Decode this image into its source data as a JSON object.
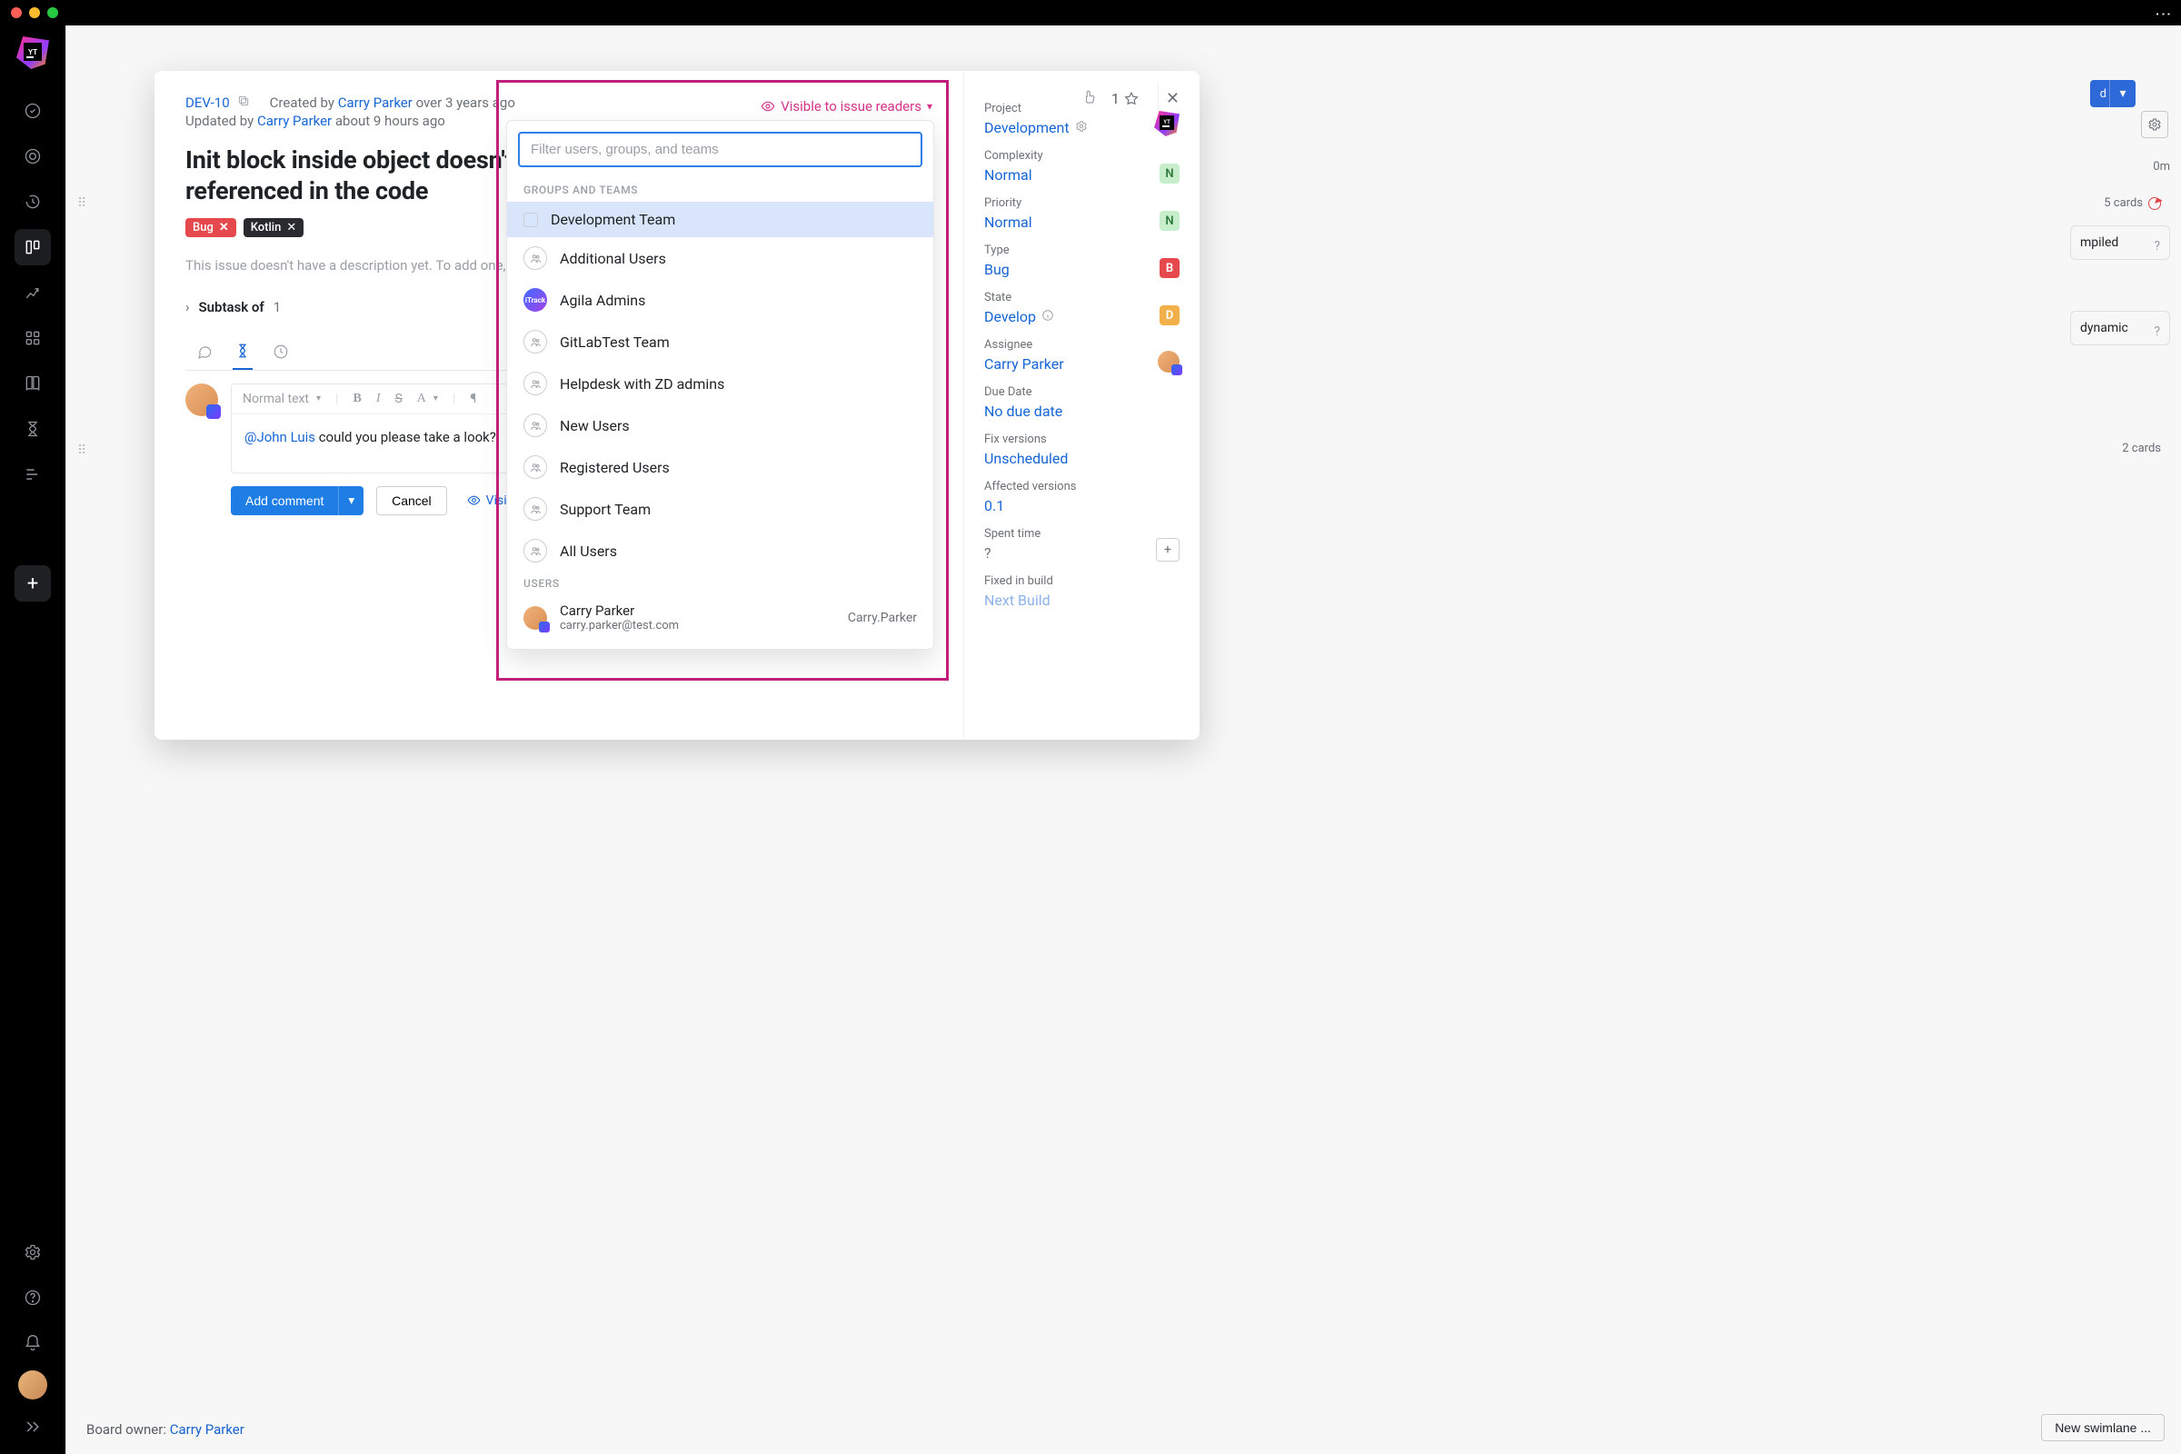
{
  "window": {
    "kebab": "⋮"
  },
  "sidebar": {
    "icons": [
      "target",
      "ring",
      "timer",
      "board",
      "chart",
      "grid",
      "book",
      "hourglass",
      "flow"
    ],
    "add": "+"
  },
  "board": {
    "time_header": "0m",
    "cards5": "5 cards",
    "card1": "mpiled",
    "card1_q": "?",
    "card2": "dynamic",
    "card2_q": "?",
    "cards2": "2 cards",
    "owner_label": "Board owner: ",
    "owner_name": "Carry Parker",
    "swimlane_btn": "New swimlane ...",
    "blue_btn": "d",
    "blue_dd": "▾"
  },
  "issue": {
    "id": "DEV-10",
    "created_prefix": "Created by ",
    "created_by": "Carry Parker",
    "created_ago": " over 3 years ago",
    "updated_prefix": "Updated by ",
    "updated_by": "Carry Parker",
    "updated_ago": " about 9 hours ago",
    "visibility": "Visible to issue readers",
    "title": "Init block inside object doesn't fire execute if the object isn't referenced in the code",
    "tags": {
      "bug": "Bug",
      "kotlin": "Kotlin"
    },
    "nodesc": "This issue doesn't have a description yet. To add one, click here.",
    "subtask_label": "Subtask of",
    "subtask_count": "1"
  },
  "editor": {
    "format_sel": "Normal text",
    "mention": "@John Luis",
    "body_rest": " could you please take a look?"
  },
  "actions": {
    "add_comment": "Add comment",
    "cancel": "Cancel",
    "vis_small": "Visible to issue readers"
  },
  "side": {
    "star_count": "1",
    "project_label": "Project",
    "project_value": "Development",
    "complexity_label": "Complexity",
    "complexity_value": "Normal",
    "complexity_badge": "N",
    "priority_label": "Priority",
    "priority_value": "Normal",
    "priority_badge": "N",
    "type_label": "Type",
    "type_value": "Bug",
    "type_badge": "B",
    "state_label": "State",
    "state_value": "Develop",
    "state_badge": "D",
    "assignee_label": "Assignee",
    "assignee_value": "Carry Parker",
    "due_label": "Due Date",
    "due_value": "No due date",
    "fixv_label": "Fix versions",
    "fixv_value": "Unscheduled",
    "affv_label": "Affected versions",
    "affv_value": "0.1",
    "spent_label": "Spent time",
    "spent_value": "?",
    "fixed_label": "Fixed in build",
    "fixed_value": "Next Build"
  },
  "dropdown": {
    "placeholder": "Filter users, groups, and teams",
    "section_groups": "Groups and Teams",
    "section_users": "Users",
    "groups": [
      {
        "label": "Development Team",
        "icon": "checkbox",
        "selected": true
      },
      {
        "label": "Additional Users",
        "icon": "people"
      },
      {
        "label": "Agila Admins",
        "icon": "color"
      },
      {
        "label": "GitLabTest Team",
        "icon": "people"
      },
      {
        "label": "Helpdesk with ZD admins",
        "icon": "people"
      },
      {
        "label": "New Users",
        "icon": "people"
      },
      {
        "label": "Registered Users",
        "icon": "people"
      },
      {
        "label": "Support Team",
        "icon": "people"
      },
      {
        "label": "All Users",
        "icon": "people"
      }
    ],
    "user": {
      "name": "Carry Parker",
      "email": "carry.parker@test.com",
      "login": "Carry.Parker"
    }
  }
}
